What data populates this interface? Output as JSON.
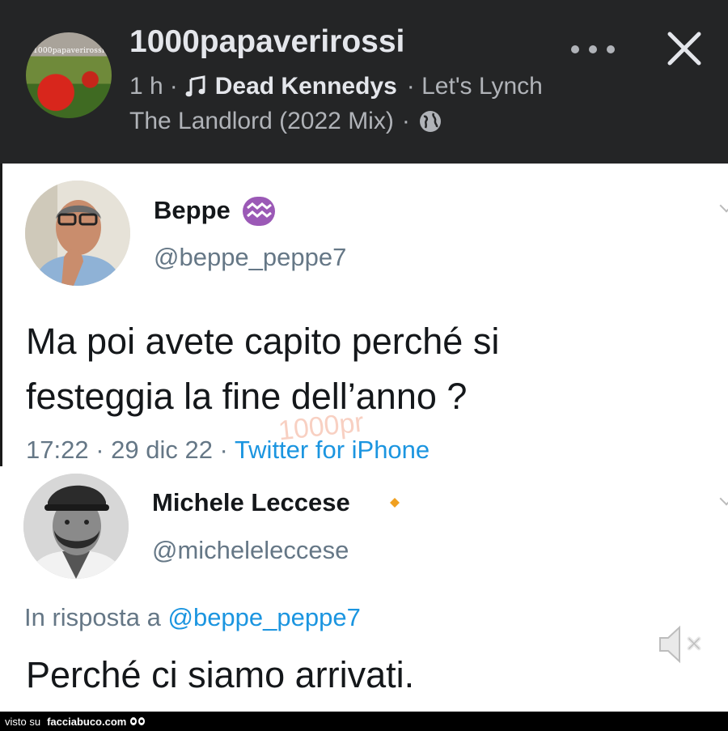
{
  "post_header": {
    "page_name": "1000papaverirossi",
    "avatar_text": "1000papaverirossi",
    "time": "1 h",
    "separator": "·",
    "artist": "Dead Kennedys",
    "song_part1": "· Let's Lynch",
    "song_part2": "The Landlord (2022 Mix)",
    "sep2": "·",
    "icons": {
      "music": "music-note-icon",
      "globe": "globe-icon",
      "more": "more-dots-icon",
      "close": "close-icon"
    }
  },
  "tweet1": {
    "name": "Beppe",
    "badge_icon": "aquarius-icon",
    "badge_color": "#9b59b6",
    "handle": "@beppe_peppe7",
    "line1": "Ma poi avete capito perché si",
    "line2": "festeggia la fine dell’anno ?",
    "time": "17:22 · 29 dic 22 · ",
    "source": "Twitter for iPhone",
    "watermark": "1000pr"
  },
  "tweet2": {
    "name": "Michele Leccese",
    "badge_icon": "diamond-icon",
    "badge_color": "#f0a020",
    "handle": "@micheleleccese",
    "reply_prefix": "In risposta a ",
    "reply_to": "@beppe_peppe7",
    "text": "Perché ci siamo arrivati."
  },
  "video": {
    "mute_icon": "muted-speaker-icon"
  },
  "footer": {
    "prefix": "visto su",
    "brand": "facciabuco.com"
  }
}
